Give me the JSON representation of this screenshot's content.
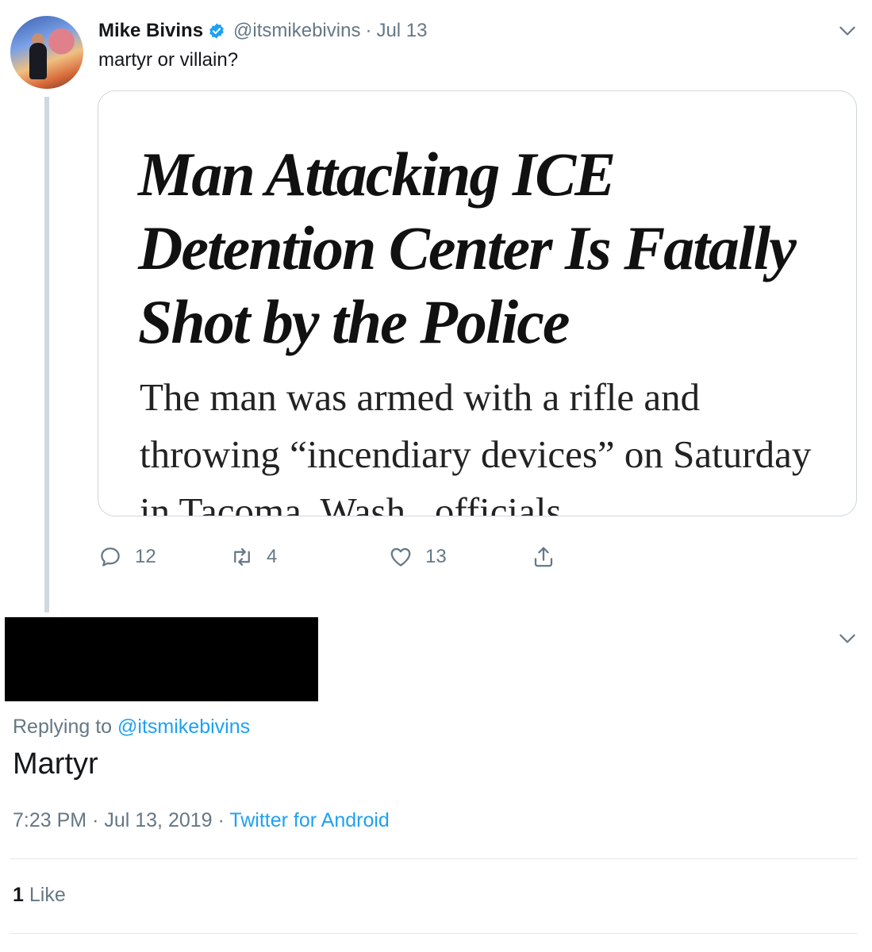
{
  "tweet": {
    "author_name": "Mike Bivins",
    "handle": "@itsmikebivins",
    "separator": "·",
    "date": "Jul 13",
    "text": "martyr or villain?",
    "card": {
      "headline": "Man Attacking ICE Detention Center Is Fatally Shot by the Police",
      "summary": "The man was armed with a rifle and throwing “incendiary devices” on Saturday in Tacoma, Wash., officials"
    },
    "actions": {
      "replies": "12",
      "retweets": "4",
      "likes": "13"
    }
  },
  "reply": {
    "replying_prefix": "Replying to",
    "replying_handle": "@itsmikebivins",
    "text": "Martyr",
    "time": "7:23 PM",
    "date": "Jul 13, 2019",
    "separator": "·",
    "source": "Twitter for Android",
    "like_count": "1",
    "like_label": "Like"
  },
  "colors": {
    "accent": "#1da1f2",
    "muted": "#657786",
    "border": "#ccd6dd",
    "verified": "#1da1f2"
  },
  "icons": [
    "verified-badge-icon",
    "chevron-down-icon",
    "reply-icon",
    "retweet-icon",
    "like-icon",
    "share-icon"
  ]
}
